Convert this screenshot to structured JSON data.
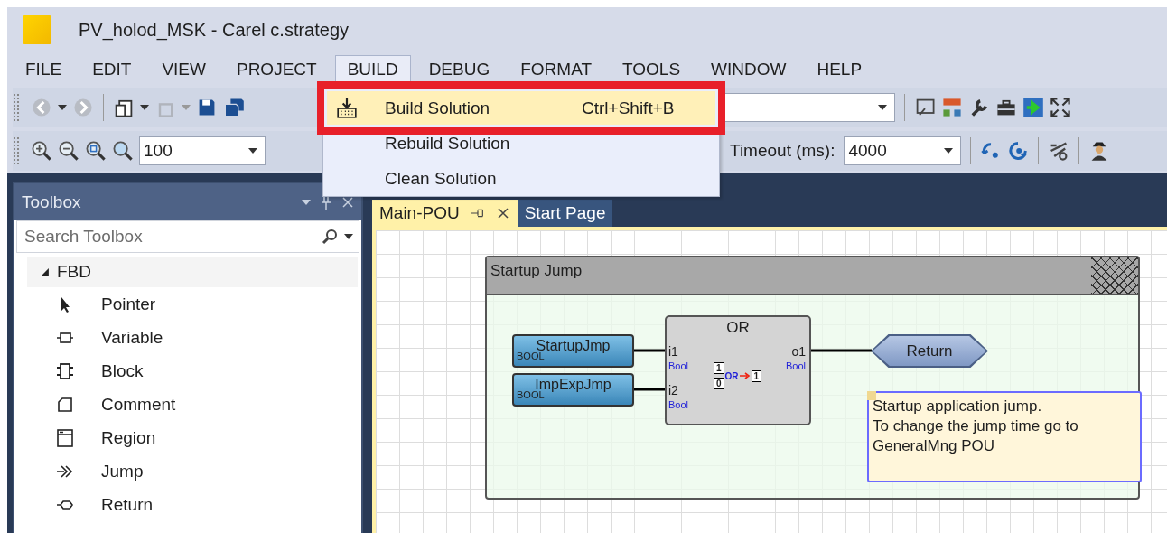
{
  "window": {
    "title": "PV_holod_MSK - Carel c.strategy"
  },
  "menu": [
    {
      "label": "FILE",
      "selected": false
    },
    {
      "label": "EDIT",
      "selected": false
    },
    {
      "label": "VIEW",
      "selected": false
    },
    {
      "label": "PROJECT",
      "selected": false
    },
    {
      "label": "BUILD",
      "selected": true
    },
    {
      "label": "DEBUG",
      "selected": false
    },
    {
      "label": "FORMAT",
      "selected": false
    },
    {
      "label": "TOOLS",
      "selected": false
    },
    {
      "label": "WINDOW",
      "selected": false
    },
    {
      "label": "HELP",
      "selected": false
    }
  ],
  "build_menu": [
    {
      "label": "Build Solution",
      "shortcut": "Ctrl+Shift+B",
      "selected": true,
      "callout": true
    },
    {
      "label": "Rebuild Solution",
      "selected": false,
      "callout": false
    },
    {
      "label": "Clean Solution",
      "selected": false,
      "callout": false
    }
  ],
  "toolbar": {
    "zoom": "100",
    "timeout_label": "Timeout (ms):",
    "timeout": "4000"
  },
  "toolbox": {
    "title": "Toolbox",
    "search_placeholder": "Search Toolbox",
    "group": {
      "label": "FBD",
      "expanded": true,
      "children": [
        {
          "label": "Pointer",
          "kind": "pointer"
        },
        {
          "label": "Variable",
          "kind": "variable"
        },
        {
          "label": "Block",
          "kind": "block"
        },
        {
          "label": "Comment",
          "kind": "comment"
        },
        {
          "label": "Region",
          "kind": "region"
        },
        {
          "label": "Jump",
          "kind": "jump"
        },
        {
          "label": "Return",
          "kind": "return"
        }
      ]
    }
  },
  "tabs": [
    {
      "label": "Main-POU",
      "selected": true
    },
    {
      "label": "Start Page",
      "selected": false
    }
  ],
  "diagram": {
    "region": {
      "title": "Startup Jump"
    },
    "variables": [
      {
        "name": "StartupJmp",
        "type": "BOOL"
      },
      {
        "name": "ImpExpJmp",
        "type": "BOOL"
      }
    ],
    "block": {
      "name": "OR",
      "inputs": [
        {
          "name": "i1",
          "type": "Bool"
        },
        {
          "name": "i2",
          "type": "Bool"
        }
      ],
      "outputs": [
        {
          "name": "o1",
          "type": "Bool"
        }
      ],
      "symbol": {
        "inputs": [
          "1",
          "0"
        ],
        "op": "OR",
        "output": "1"
      }
    },
    "return": {
      "label": "Return"
    },
    "comment": {
      "text": "Startup application jump.\nTo change the jump time go to\nGeneralMng POU"
    }
  }
}
